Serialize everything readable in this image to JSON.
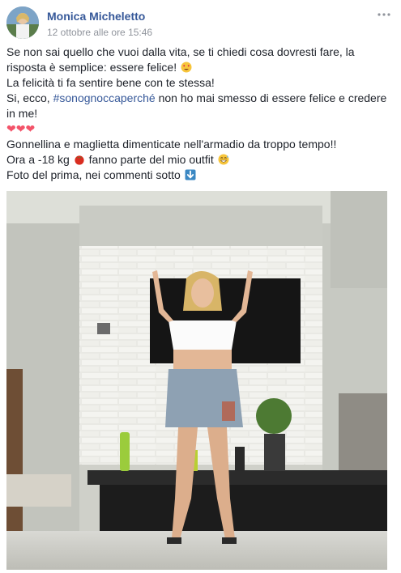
{
  "post": {
    "author": "Monica Micheletto",
    "timestamp": "12 ottobre alle ore 15:46",
    "more_icon": "ellipsis-icon",
    "text": {
      "line1": "Se non sai quello che vuoi dalla vita, se ti chiedi cosa dovresti fare, la",
      "line2": "risposta è semplice: essere felice!",
      "line3": "La felicità ti fa sentire bene con te stessa!",
      "line4_before": "Si, ecco,",
      "hashtag": "#sonognoccaperché",
      "line4_after": "non ho mai smesso di essere felice e credere",
      "line5": "in me!",
      "hearts": "❤❤❤",
      "line7": "Gonnellina e maglietta dimenticate nell'armadio da troppo tempo!!",
      "line8_before": "Ora a -18 kg",
      "line8_after": "fanno parte del mio outfit",
      "line9": "Foto del prima, nei commenti sotto"
    },
    "emojis": [
      "heart-eyes-emoji",
      "tomato-emoji",
      "grin-sweat-emoji",
      "down-arrow-emoji"
    ],
    "colors": {
      "link": "#365899",
      "text": "#1d2129",
      "meta": "#90949c",
      "heart": "#f35369"
    }
  }
}
